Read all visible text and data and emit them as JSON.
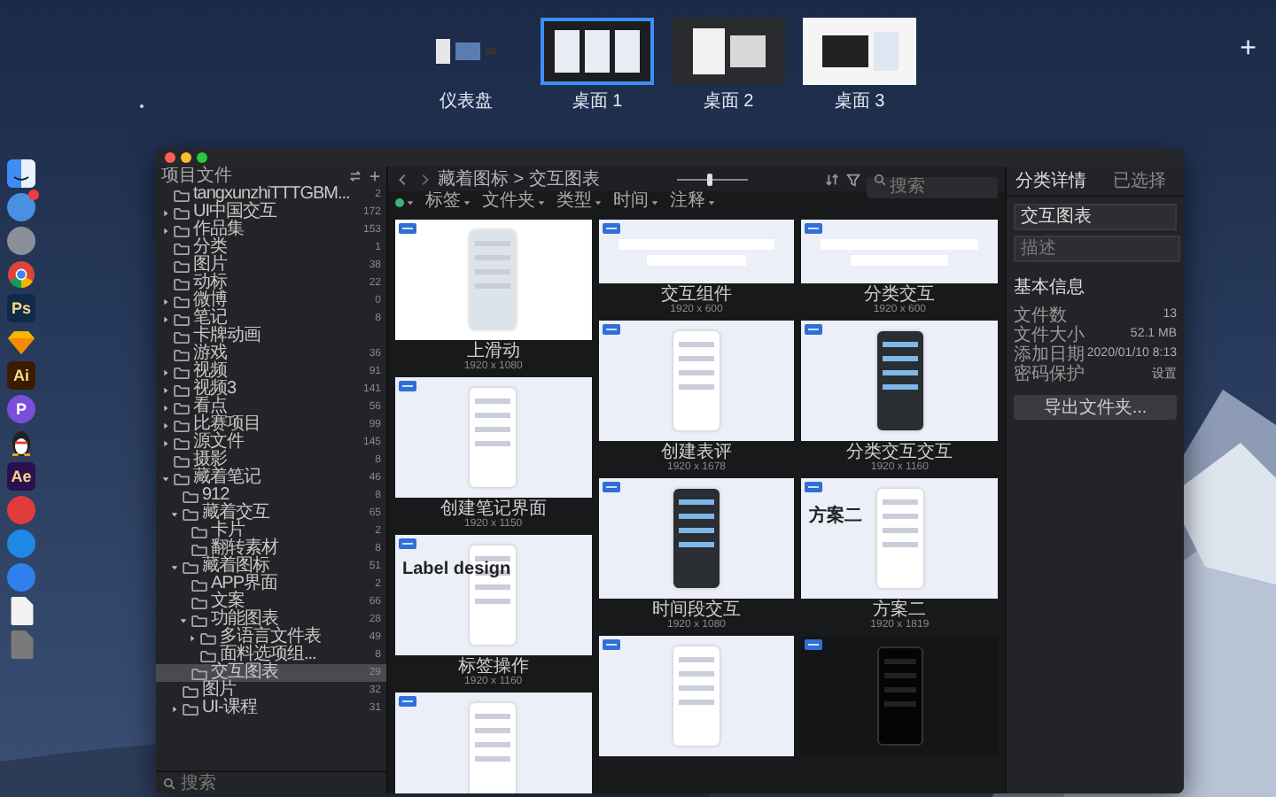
{
  "spaces": [
    {
      "label": "仪表盘",
      "selected": false,
      "kind": "dashboard"
    },
    {
      "label": "桌面 1",
      "selected": true,
      "kind": "gallery"
    },
    {
      "label": "桌面 2",
      "selected": false,
      "kind": "dark"
    },
    {
      "label": "桌面 3",
      "selected": false,
      "kind": "light"
    }
  ],
  "add_space": "+",
  "dock": [
    {
      "kind": "finder",
      "color": "#3d8df5",
      "badge": false
    },
    {
      "kind": "disc",
      "color": "#4a90e2",
      "badge": true
    },
    {
      "kind": "disc",
      "color": "#8a8f99",
      "badge": false
    },
    {
      "kind": "chrome",
      "color": "#db4437",
      "badge": false
    },
    {
      "kind": "tile",
      "color": "#0f2a4a",
      "glyph": "Ps",
      "badge": false
    },
    {
      "kind": "gem",
      "color": "#f7b500",
      "badge": false
    },
    {
      "kind": "tile",
      "color": "#3a1c00",
      "glyph": "Ai",
      "badge": false
    },
    {
      "kind": "disc",
      "color": "#7b4ddb",
      "glyph": "P",
      "badge": false
    },
    {
      "kind": "penguin",
      "color": "#222222",
      "badge": false
    },
    {
      "kind": "tile",
      "color": "#2a1050",
      "glyph": "Ae",
      "badge": false
    },
    {
      "kind": "disc",
      "color": "#e23b3b",
      "badge": false
    },
    {
      "kind": "disc",
      "color": "#1e88e5",
      "badge": false
    },
    {
      "kind": "disc",
      "color": "#2f80ed",
      "badge": false
    },
    {
      "kind": "page",
      "color": "#f2f2f2",
      "badge": false
    },
    {
      "kind": "page",
      "color": "#7a7a7a",
      "badge": false
    }
  ],
  "window": {
    "sidebar": {
      "title": "项目文件",
      "search_placeholder": "搜索",
      "items": [
        {
          "label": "tangxunzhiTTTGBM...",
          "count": "2",
          "expandable": false,
          "selected": false
        },
        {
          "label": "UI中国交互",
          "count": "172",
          "expandable": true,
          "expanded": false,
          "selected": false
        },
        {
          "label": "作品集",
          "count": "153",
          "expandable": true,
          "expanded": false,
          "selected": false
        },
        {
          "label": "分类",
          "count": "1",
          "expandable": false,
          "selected": false
        },
        {
          "label": "图片",
          "count": "38",
          "expandable": false,
          "selected": false
        },
        {
          "label": "动标",
          "count": "22",
          "expandable": false,
          "selected": false
        },
        {
          "label": "微博",
          "count": "0",
          "expandable": true,
          "expanded": false,
          "selected": false
        },
        {
          "label": "笔记",
          "count": "8",
          "expandable": true,
          "expanded": false,
          "selected": false
        },
        {
          "label": "卡牌动画",
          "expandable": false,
          "selected": false
        },
        {
          "label": "游戏",
          "count": "36",
          "expandable": false,
          "selected": false
        },
        {
          "label": "视频",
          "count": "91",
          "expandable": true,
          "expanded": false,
          "selected": false
        },
        {
          "label": "视频3",
          "count": "141",
          "expandable": true,
          "expanded": false,
          "selected": false
        },
        {
          "label": "看点",
          "count": "56",
          "expandable": true,
          "expanded": false,
          "selected": false
        },
        {
          "label": "比赛项目",
          "count": "99",
          "expandable": true,
          "expanded": false,
          "selected": false
        },
        {
          "label": "源文件",
          "count": "145",
          "expandable": true,
          "expanded": false,
          "selected": false
        },
        {
          "label": "摄影",
          "count": "8",
          "expandable": false,
          "selected": false
        },
        {
          "label": "藏着笔记",
          "count": "46",
          "expandable": true,
          "expanded": true,
          "selected": false,
          "children": [
            {
              "label": "912",
              "count": "8",
              "expandable": false,
              "selected": false
            },
            {
              "label": "藏着交互",
              "count": "65",
              "expandable": true,
              "expanded": true,
              "selected": false,
              "children": [
                {
                  "label": "卡片",
                  "count": "2",
                  "expandable": false,
                  "selected": false
                },
                {
                  "label": "翻转素材",
                  "count": "8",
                  "expandable": false,
                  "selected": false
                }
              ]
            },
            {
              "label": "藏着图标",
              "count": "51",
              "expandable": true,
              "expanded": true,
              "selected": false,
              "children": [
                {
                  "label": "APP界面",
                  "count": "2",
                  "expandable": false,
                  "selected": false
                },
                {
                  "label": "文案",
                  "count": "66",
                  "expandable": false,
                  "selected": false
                },
                {
                  "label": "功能图表",
                  "count": "28",
                  "expandable": true,
                  "expanded": true,
                  "selected": false,
                  "children": [
                    {
                      "label": "多语言文件表",
                      "count": "49",
                      "expandable": true,
                      "expanded": false,
                      "selected": false
                    },
                    {
                      "label": "面料选项组...",
                      "count": "8",
                      "expandable": false,
                      "selected": false
                    }
                  ]
                },
                {
                  "label": "交互图表",
                  "count": "29",
                  "expandable": false,
                  "selected": true
                }
              ]
            },
            {
              "label": "图片",
              "count": "32",
              "expandable": false,
              "selected": false
            },
            {
              "label": "UI-课程",
              "count": "31",
              "expandable": true,
              "expanded": false,
              "selected": false
            }
          ]
        }
      ]
    },
    "toolbar": {
      "breadcrumb": "藏着图标 > 交互图表",
      "zoom": {
        "level": 0.45
      },
      "search_placeholder": "搜索"
    },
    "filters": [
      {
        "kind": "color",
        "color": "#3cb371"
      },
      {
        "kind": "menu",
        "label": "标签"
      },
      {
        "kind": "menu",
        "label": "文件夹"
      },
      {
        "kind": "menu",
        "label": "类型"
      },
      {
        "kind": "menu",
        "label": "时间"
      },
      {
        "kind": "menu",
        "label": "注释"
      }
    ],
    "gallery": {
      "columns": [
        [
          {
            "title": "上滑动",
            "size": "1920 x 1080",
            "kind": "blank"
          },
          {
            "title": "创建笔记界面",
            "size": "1920 x 1150",
            "kind": "screen"
          },
          {
            "title": "标签操作",
            "size": "1920 x 1160",
            "kind": "screen",
            "heading": "Label design"
          },
          {
            "kind": "screen"
          }
        ],
        [
          {
            "title": "交互组件",
            "size": "1920 x 600",
            "kind": "banner"
          },
          {
            "title": "创建表评",
            "size": "1920 x 1678",
            "kind": "screen"
          },
          {
            "title": "时间段交互",
            "size": "1920 x 1080",
            "kind": "dark"
          },
          {
            "kind": "screen"
          }
        ],
        [
          {
            "title": "分类交互",
            "size": "1920 x 600",
            "kind": "banner"
          },
          {
            "title": "分类交互交互",
            "size": "1920 x 1160",
            "kind": "dark"
          },
          {
            "title": "方案二",
            "size": "1920 x 1819",
            "kind": "screen",
            "heading": "方案二"
          },
          {
            "kind": "night"
          }
        ]
      ]
    },
    "inspector": {
      "tabs": [
        {
          "label": "分类详情",
          "selected": true
        },
        {
          "label": "已选择",
          "selected": false
        }
      ],
      "name": "交互图表",
      "description_placeholder": "描述",
      "section": "基本信息",
      "rows": [
        {
          "label": "文件数",
          "value": "13"
        },
        {
          "label": "文件大小",
          "value": "52.1 MB"
        },
        {
          "label": "添加日期",
          "value": "2020/01/10 8:13"
        },
        {
          "label": "密码保护",
          "value": "设置"
        }
      ],
      "button": "导出文件夹..."
    }
  }
}
